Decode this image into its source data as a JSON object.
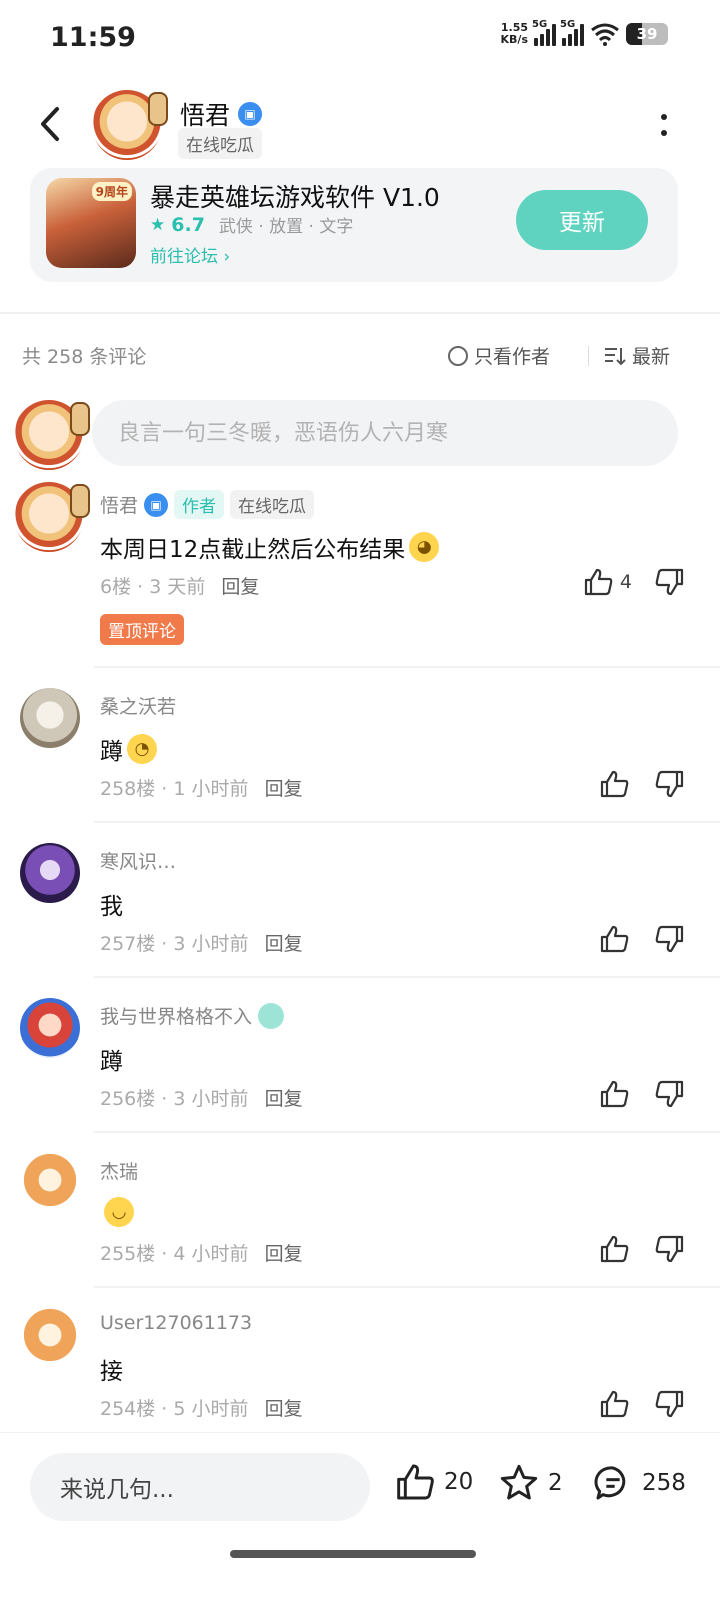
{
  "status_bar": {
    "time": "11:59",
    "net_speed_top": "1.55",
    "net_speed_bottom": "KB/s",
    "signal_tag": "5G",
    "battery": "39"
  },
  "header": {
    "author_name": "悟君",
    "author_status": "在线吃瓜"
  },
  "game": {
    "title": "暴走英雄坛游戏软件 V1.0",
    "rating": "6.7",
    "tags": "武侠 · 放置 · 文字",
    "forum_link": "前往论坛",
    "update_label": "更新",
    "anniversary": "9周年"
  },
  "toolbar": {
    "comment_count": "共 258 条评论",
    "only_author": "只看作者",
    "sort": "最新"
  },
  "input": {
    "placeholder": "良言一句三冬暖，恶语伤人六月寒"
  },
  "comments": [
    {
      "name": "悟君",
      "author_tag": "作者",
      "status_tag": "在线吃瓜",
      "text": "本周日12点截止然后公布结果",
      "floor": "6楼",
      "time": "3 天前",
      "reply": "回复",
      "likes": "4",
      "pinned": "置顶评论"
    },
    {
      "name": "桑之沃若",
      "text": "蹲",
      "floor": "258楼",
      "time": "1 小时前",
      "reply": "回复"
    },
    {
      "name": "寒风识…",
      "text": "我",
      "floor": "257楼",
      "time": "3 小时前",
      "reply": "回复"
    },
    {
      "name": "我与世界格格不入",
      "text": "蹲",
      "floor": "256楼",
      "time": "3 小时前",
      "reply": "回复"
    },
    {
      "name": "杰瑞",
      "text": "",
      "floor": "255楼",
      "time": "4 小时前",
      "reply": "回复"
    },
    {
      "name": "User127061173",
      "text": "接",
      "floor": "254楼",
      "time": "5 小时前",
      "reply": "回复"
    }
  ],
  "bottom_bar": {
    "input_placeholder": "来说几句...",
    "likes": "20",
    "favorites": "2",
    "comments": "258"
  },
  "colors": {
    "accent": "#2bbfae",
    "update_button": "#5fd3c0",
    "pinned_tag": "#f07a4a",
    "verify_badge": "#3a8ef0"
  }
}
